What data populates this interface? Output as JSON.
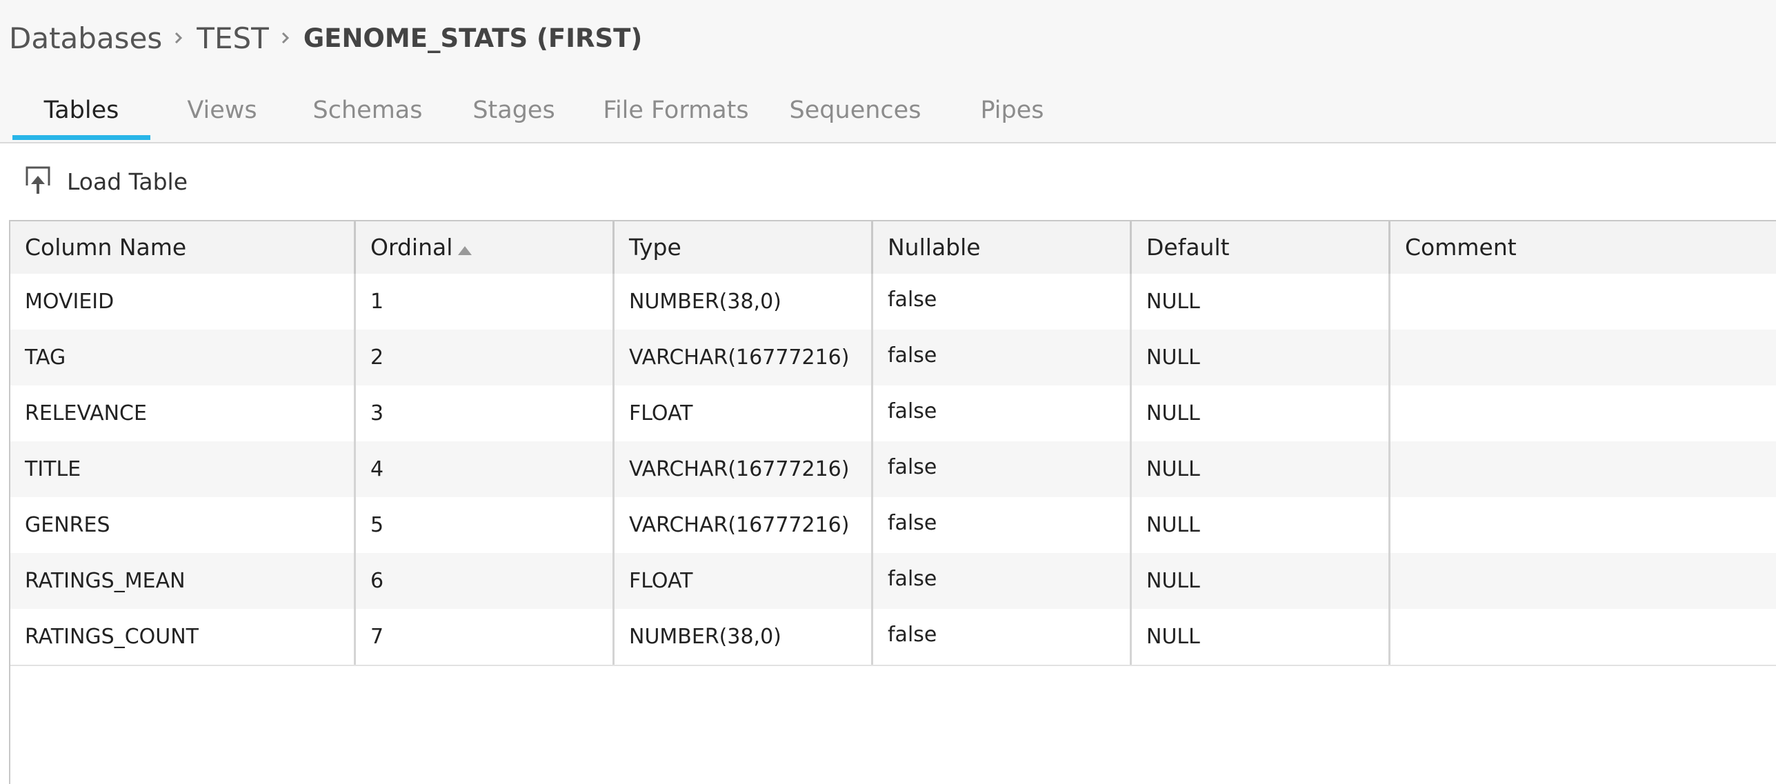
{
  "breadcrumb": {
    "items": [
      "Databases",
      "TEST"
    ],
    "current": "GENOME_STATS (FIRST)"
  },
  "tabs": [
    {
      "label": "Tables",
      "active": true
    },
    {
      "label": "Views"
    },
    {
      "label": "Schemas"
    },
    {
      "label": "Stages"
    },
    {
      "label": "File Formats"
    },
    {
      "label": "Sequences"
    },
    {
      "label": "Pipes"
    }
  ],
  "toolbar": {
    "load_table_label": "Load Table",
    "load_table_icon": "load-table-icon"
  },
  "grid": {
    "sort": {
      "column": "Ordinal",
      "direction": "ascending"
    },
    "columns": [
      "Column Name",
      "Ordinal",
      "Type",
      "Nullable",
      "Default",
      "Comment"
    ],
    "rows": [
      [
        "MOVIEID",
        "1",
        "NUMBER(38,0)",
        "false",
        "NULL",
        ""
      ],
      [
        "TAG",
        "2",
        "VARCHAR(16777216)",
        "false",
        "NULL",
        ""
      ],
      [
        "RELEVANCE",
        "3",
        "FLOAT",
        "false",
        "NULL",
        ""
      ],
      [
        "TITLE",
        "4",
        "VARCHAR(16777216)",
        "false",
        "NULL",
        ""
      ],
      [
        "GENRES",
        "5",
        "VARCHAR(16777216)",
        "false",
        "NULL",
        ""
      ],
      [
        "RATINGS_MEAN",
        "6",
        "FLOAT",
        "false",
        "NULL",
        ""
      ],
      [
        "RATINGS_COUNT",
        "7",
        "NUMBER(38,0)",
        "false",
        "NULL",
        ""
      ]
    ]
  },
  "colors": {
    "accent": "#29b5e8",
    "header_bg": "#f7f7f7",
    "row_alt_bg": "#f6f6f6"
  }
}
